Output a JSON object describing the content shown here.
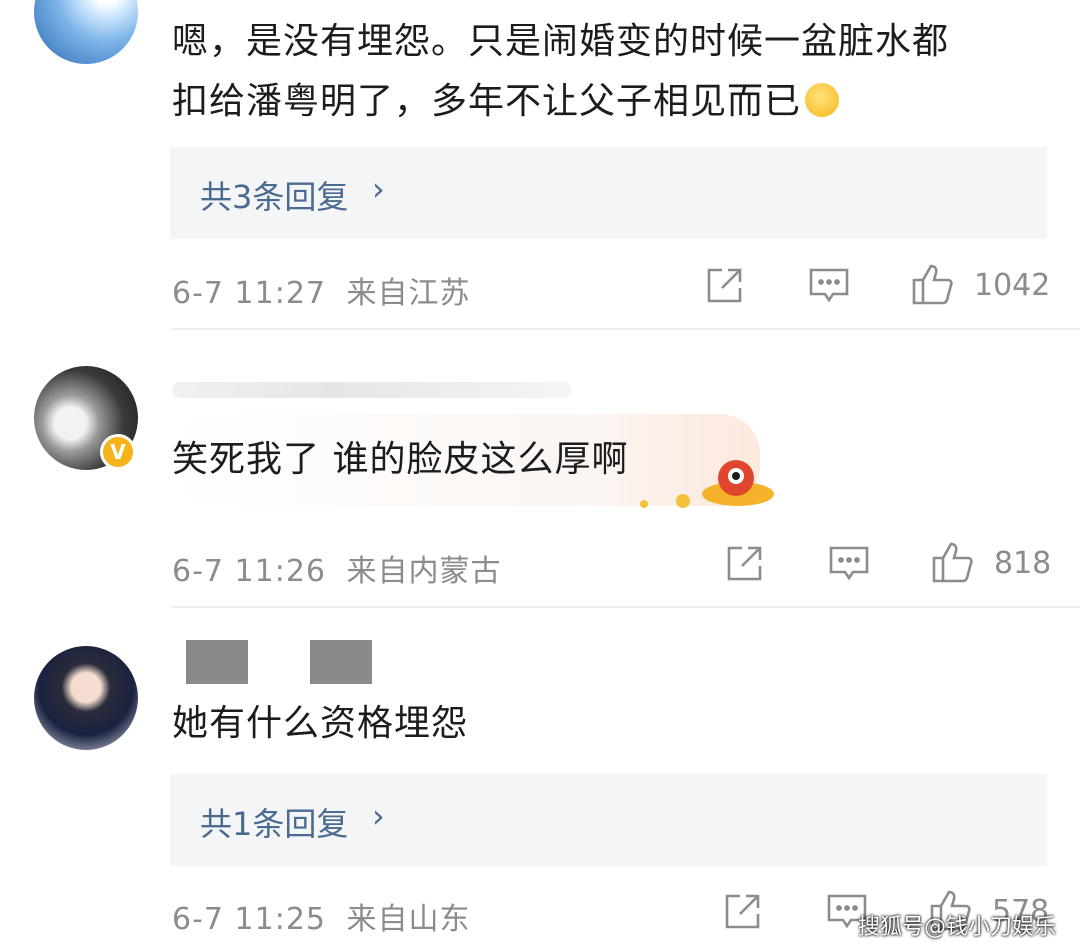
{
  "comments": [
    {
      "text_line1": "嗯，是没有埋怨。只是闹婚变的时候一盆脏水都",
      "text_line2": "扣给潘粤明了，多年不让父子相见而已",
      "replies_label": "共3条回复",
      "time": "6-7 11:27",
      "location": "来自江苏",
      "likes": "1042"
    },
    {
      "text_line1": "笑死我了 谁的脸皮这么厚啊",
      "time": "6-7 11:26",
      "location": "来自内蒙古",
      "likes": "818"
    },
    {
      "text_line1": "她有什么资格埋怨",
      "replies_label": "共1条回复",
      "time": "6-7 11:25",
      "location": "来自山东",
      "likes": "578"
    }
  ],
  "icons": {
    "share": "share-icon",
    "comment": "comment-icon",
    "like": "thumbs-up-icon",
    "chevron": "chevron-right-icon"
  },
  "colors": {
    "reply_link": "#4a6b8f",
    "meta_gray": "#8c8c8c",
    "reply_bg": "#f4f5f7",
    "verified_badge": "#f6b31b"
  },
  "watermark": "搜狐号@钱小刀娱乐"
}
